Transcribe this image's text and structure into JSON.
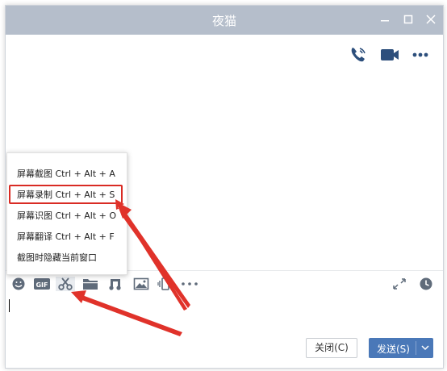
{
  "window": {
    "title": "夜猫",
    "controls": [
      "minimize-icon",
      "maximize-icon",
      "close-icon"
    ]
  },
  "header_actions": [
    "phone-call-icon",
    "video-call-icon",
    "more-icon"
  ],
  "context_menu": {
    "items": [
      {
        "label": "屏幕截图 Ctrl + Alt + A"
      },
      {
        "label": "屏幕录制 Ctrl + Alt + S",
        "highlighted": true
      },
      {
        "label": "屏幕识图 Ctrl + Alt + O"
      },
      {
        "label": "屏幕翻译 Ctrl + Alt + F"
      },
      {
        "label": "截图时隐藏当前窗口"
      }
    ]
  },
  "toolbar": {
    "tools": [
      "emoji-icon",
      "gif-icon",
      "scissors-icon",
      "folder-icon",
      "music-icon",
      "image-icon",
      "screen-shake-icon",
      "more-icon"
    ],
    "right_tools": [
      "expand-icon",
      "history-clock-icon"
    ],
    "gif_label": "GIF"
  },
  "buttons": {
    "close_label": "关闭(C)",
    "send_label": "发送(S)"
  },
  "colors": {
    "titlebar": "#b5becb",
    "send_button": "#4a78b8",
    "highlight_red": "#d92b24",
    "icon_gray": "#5f6b7a",
    "icon_blue": "#2d4f7c"
  }
}
